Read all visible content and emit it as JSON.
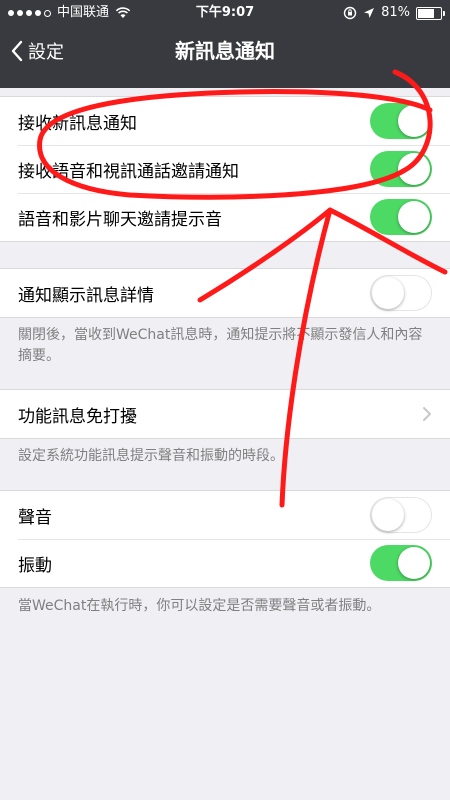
{
  "status_bar": {
    "carrier": "中国联通",
    "time": "下午9:07",
    "battery": "81%",
    "battery_level": 0.81
  },
  "nav": {
    "back_label": "設定",
    "title": "新訊息通知"
  },
  "group1": {
    "items": [
      {
        "label": "接收新訊息通知",
        "on": true
      },
      {
        "label": "接收語音和視訊通話邀請通知",
        "on": true
      },
      {
        "label": "語音和影片聊天邀請提示音",
        "on": true
      }
    ]
  },
  "group2": {
    "item": {
      "label": "通知顯示訊息詳情",
      "on": false
    },
    "note": "關閉後，當收到WeChat訊息時，通知提示將不顯示發信人和內容摘要。"
  },
  "group3": {
    "item": {
      "label": "功能訊息免打擾"
    },
    "note": "設定系統功能訊息提示聲音和振動的時段。"
  },
  "group4": {
    "items": [
      {
        "label": "聲音",
        "on": false
      },
      {
        "label": "振動",
        "on": true
      }
    ],
    "note": "當WeChat在執行時，你可以設定是否需要聲音或者振動。"
  },
  "colors": {
    "navbar": "#393a3f",
    "toggle_on": "#4cd964",
    "annotation": "#ff1a1a",
    "background": "#efeff4"
  },
  "icons": [
    "signal-dots-icon",
    "wifi-icon",
    "location-arrow-icon",
    "rotation-lock-icon",
    "battery-icon",
    "back-chevron-icon",
    "chevron-right-icon"
  ]
}
